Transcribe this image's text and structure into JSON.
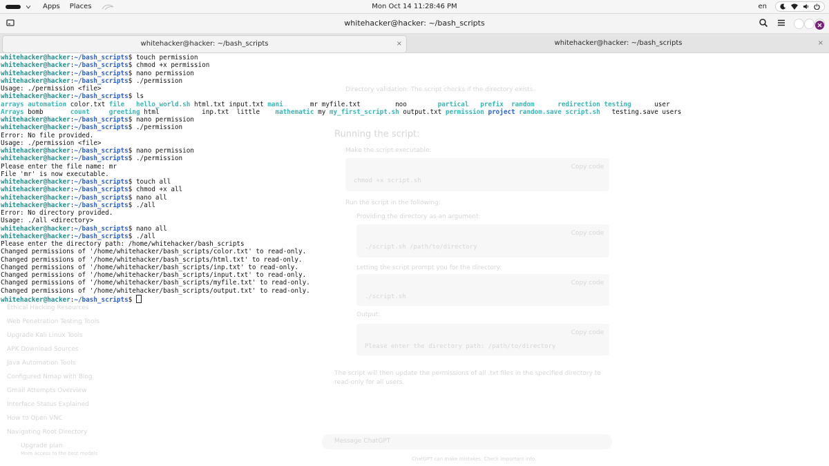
{
  "topbar": {
    "apps_label": "Apps",
    "places_label": "Places",
    "clock": "Mon Oct 14  11:28:46 PM",
    "lang": "en"
  },
  "window": {
    "title": "whitehacker@hacker: ~/bash_scripts"
  },
  "tabs": [
    {
      "label": "whitehacker@hacker: ~/bash_scripts",
      "close": "×"
    },
    {
      "label": "whitehacker@hacker: ~/bash_scripts",
      "close": "×"
    }
  ],
  "terminal": {
    "user_host": "whitehacker@hacker",
    "path": "~/bash_scripts",
    "prompt_end": "$",
    "ls_row1": [
      {
        "t": "arrays",
        "c": "dir"
      },
      {
        "t": "automation",
        "c": "dir"
      },
      {
        "t": "color.txt",
        "c": ""
      },
      {
        "t": "file",
        "c": "dir"
      },
      {
        "t": "hello_world.sh",
        "c": "exe"
      },
      {
        "t": "html.txt",
        "c": ""
      },
      {
        "t": "input.txt",
        "c": ""
      },
      {
        "t": "mani",
        "c": "dir"
      },
      {
        "t": "mr",
        "c": ""
      },
      {
        "t": "myfile.txt",
        "c": ""
      },
      {
        "t": "noo",
        "c": ""
      },
      {
        "t": "partical",
        "c": "dir"
      },
      {
        "t": "prefix",
        "c": "dir"
      },
      {
        "t": "random",
        "c": "dir"
      },
      {
        "t": "redirection",
        "c": "dir"
      },
      {
        "t": "testing",
        "c": "dir"
      },
      {
        "t": "user",
        "c": ""
      }
    ],
    "ls_row2": [
      {
        "t": "Arrays",
        "c": "dir"
      },
      {
        "t": "bomb",
        "c": ""
      },
      {
        "t": "count",
        "c": "dir"
      },
      {
        "t": "greeting",
        "c": "dir"
      },
      {
        "t": "html",
        "c": ""
      },
      {
        "t": "inp.txt",
        "c": ""
      },
      {
        "t": "little",
        "c": ""
      },
      {
        "t": "mathematic",
        "c": "dir"
      },
      {
        "t": "my",
        "c": ""
      },
      {
        "t": "my_first_script.sh",
        "c": "exe"
      },
      {
        "t": "output.txt",
        "c": ""
      },
      {
        "t": "permission",
        "c": "dir"
      },
      {
        "t": "project",
        "c": "p"
      },
      {
        "t": "random.save",
        "c": "dir"
      },
      {
        "t": "script.sh",
        "c": "dir"
      },
      {
        "t": "testing.save",
        "c": ""
      },
      {
        "t": "users",
        "c": ""
      }
    ],
    "lines": [
      {
        "type": "cmd",
        "text": " touch permission"
      },
      {
        "type": "cmd",
        "text": " chmod +x permission"
      },
      {
        "type": "cmd",
        "text": " nano permission"
      },
      {
        "type": "cmd",
        "text": " ./permission"
      },
      {
        "type": "out",
        "text": "Usage: ./permission <file>"
      },
      {
        "type": "cmd",
        "text": " ls"
      },
      {
        "type": "ls1"
      },
      {
        "type": "ls2"
      },
      {
        "type": "cmd",
        "text": " nano permission"
      },
      {
        "type": "cmd",
        "text": " ./permission"
      },
      {
        "type": "out",
        "text": "Error: No file provided."
      },
      {
        "type": "out",
        "text": "Usage: ./permission <file>"
      },
      {
        "type": "cmd",
        "text": " nano permission"
      },
      {
        "type": "cmd",
        "text": " ./permission"
      },
      {
        "type": "out",
        "text": "Please enter the file name: mr"
      },
      {
        "type": "out",
        "text": "File 'mr' is now executable."
      },
      {
        "type": "cmd",
        "text": " touch all"
      },
      {
        "type": "cmd",
        "text": " chmod +x all"
      },
      {
        "type": "cmd",
        "text": " nano all"
      },
      {
        "type": "cmd",
        "text": " ./all"
      },
      {
        "type": "out",
        "text": "Error: No directory provided."
      },
      {
        "type": "out",
        "text": "Usage: ./all <directory>"
      },
      {
        "type": "cmd",
        "text": " nano all"
      },
      {
        "type": "cmd",
        "text": " ./all"
      },
      {
        "type": "out",
        "text": "Please enter the directory path: /home/whitehacker/bash_scripts"
      },
      {
        "type": "out",
        "text": "Changed permissions of '/home/whitehacker/bash_scripts/color.txt' to read-only."
      },
      {
        "type": "out",
        "text": "Changed permissions of '/home/whitehacker/bash_scripts/html.txt' to read-only."
      },
      {
        "type": "out",
        "text": "Changed permissions of '/home/whitehacker/bash_scripts/inp.txt' to read-only."
      },
      {
        "type": "out",
        "text": "Changed permissions of '/home/whitehacker/bash_scripts/input.txt' to read-only."
      },
      {
        "type": "out",
        "text": "Changed permissions of '/home/whitehacker/bash_scripts/myfile.txt' to read-only."
      },
      {
        "type": "out",
        "text": "Changed permissions of '/home/whitehacker/bash_scripts/output.txt' to read-only."
      },
      {
        "type": "prompt",
        "text": " "
      }
    ]
  },
  "ghost": {
    "section_title": "Running the script:",
    "step_make": "Make the script executable:",
    "code_chmod": "chmod +x script.sh",
    "step_run": "Run the script in the following:",
    "path_arg": "Providing the directory as an argument:",
    "code_run_arg": "./script.sh /path/to/directory",
    "prompt_dir": "Letting the script prompt you for the directory:",
    "code_run": "./script.sh",
    "output_label": "Output:",
    "code_output": "Please enter the directory path: /path/to/directory",
    "summary": "The script will then update the permissions of all .txt files in the specified directory to read-only for all users.",
    "message_placeholder": "Message ChatGPT",
    "footer_note": "ChatGPT can make mistakes. Check important info.",
    "dir_validation": "Directory validation: The script checks if the directory exists.",
    "copy_code": "Copy code",
    "sidebar_items": [
      "Ethical Hacking Resources",
      "Web Penetration Testing Tools",
      "Upgrade Kali Linux Tools",
      "APK Download Sources",
      "Java Automation Tools",
      "Configured Nmap with Blog",
      "Gmail Attempts Overview",
      "Interface Status Explained",
      "How to Open VNC",
      "Navigating Root Directory"
    ],
    "upgrade_plan": "Upgrade plan",
    "upgrade_sub": "More access to the best models"
  }
}
